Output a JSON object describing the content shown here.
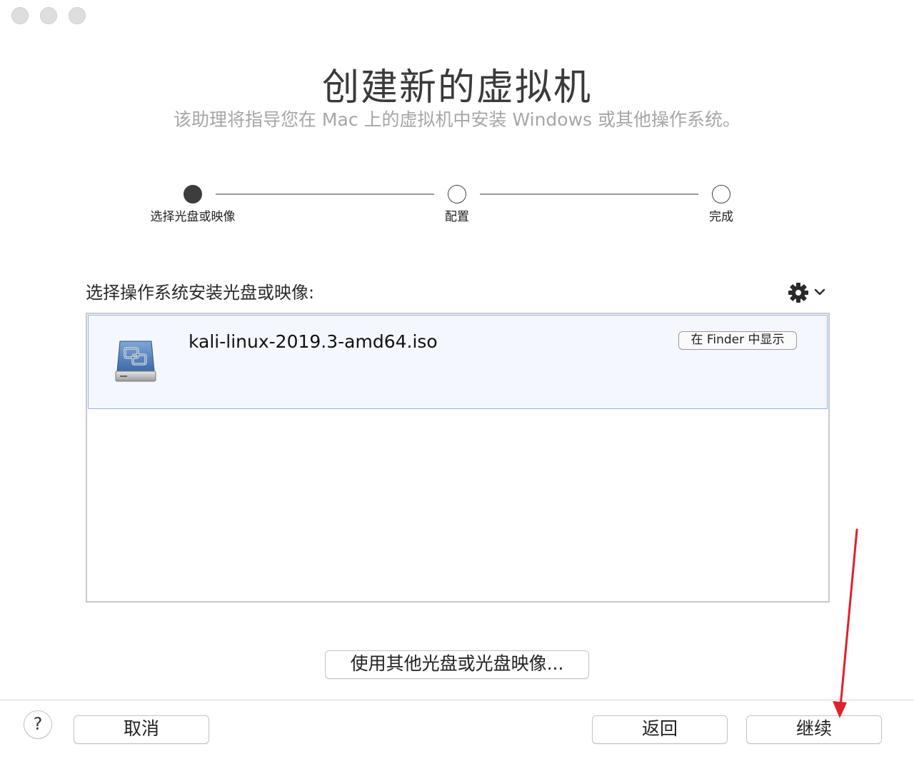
{
  "window": {
    "traffic_lights": [
      "close",
      "minimize",
      "zoom"
    ]
  },
  "header": {
    "title": "创建新的虚拟机",
    "subtitle": "该助理将指导您在 Mac 上的虚拟机中安装 Windows 或其他操作系统。"
  },
  "stepper": {
    "steps": [
      {
        "label": "选择光盘或映像",
        "active": true
      },
      {
        "label": "配置",
        "active": false
      },
      {
        "label": "完成",
        "active": false
      }
    ]
  },
  "list": {
    "caption": "选择操作系统安装光盘或映像:",
    "gear_icon": "gear-icon",
    "items": [
      {
        "icon": "disk-image-icon",
        "name": "kali-linux-2019.3-amd64.iso",
        "finder_label": "在 Finder 中显示",
        "selected": true
      }
    ]
  },
  "actions": {
    "other_disc_label": "使用其他光盘或光盘映像..."
  },
  "footer": {
    "help_label": "?",
    "cancel_label": "取消",
    "back_label": "返回",
    "continue_label": "继续"
  },
  "colors": {
    "selection_bg": "#f4f7fd",
    "selection_border": "#8fb3e6",
    "annotation_arrow": "#e0202a"
  }
}
